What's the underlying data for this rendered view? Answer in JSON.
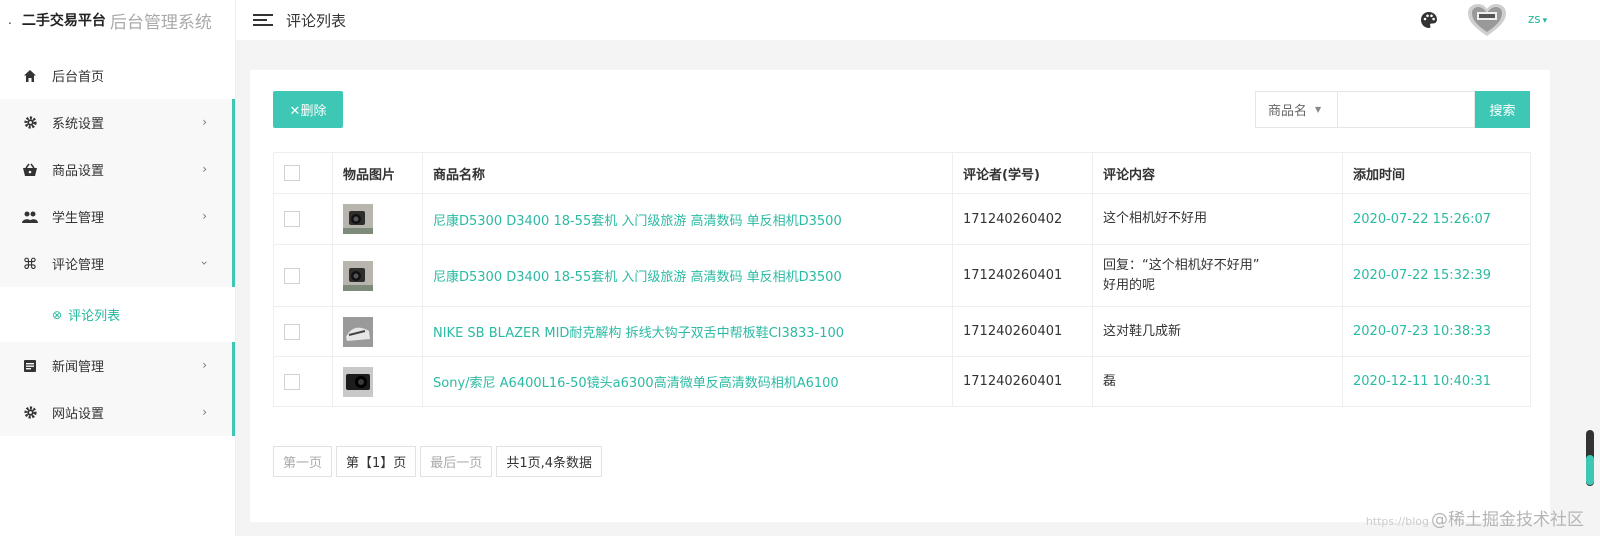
{
  "brand": {
    "prefix": ".",
    "title": "二手交易平台",
    "subtitle": "后台管理系统"
  },
  "header": {
    "page_title": "评论列表",
    "user_name": "zs"
  },
  "sidebar": {
    "items": [
      {
        "label": "后台首页",
        "icon": "home-icon"
      },
      {
        "label": "系统设置",
        "icon": "gear-icon"
      },
      {
        "label": "商品设置",
        "icon": "basket-icon"
      },
      {
        "label": "学生管理",
        "icon": "people-icon"
      },
      {
        "label": "评论管理",
        "icon": "command-icon"
      },
      {
        "label": "新闻管理",
        "icon": "news-icon"
      },
      {
        "label": "网站设置",
        "icon": "gear-icon"
      }
    ],
    "submenu": {
      "label": "评论列表"
    }
  },
  "toolbar": {
    "delete_label": "✕删除",
    "search_field_selected": "商品名",
    "search_placeholder": "",
    "search_label": "搜索"
  },
  "table": {
    "headers": [
      "物品图片",
      "商品名称",
      "评论者(学号)",
      "评论内容",
      "添加时间"
    ],
    "rows": [
      {
        "product": "尼康D5300 D3400 18-55套机 入门级旅游 高清数码 单反相机D3500",
        "reviewer": "171240260402",
        "content": "这个相机好不好用",
        "content2": "",
        "time": "2020-07-22 15:26:07"
      },
      {
        "product": "尼康D5300 D3400 18-55套机 入门级旅游 高清数码 单反相机D3500",
        "reviewer": "171240260401",
        "content": "回复：“这个相机好不好用”",
        "content2": "好用的呢",
        "time": "2020-07-22 15:32:39"
      },
      {
        "product": "NIKE SB BLAZER MID耐克解构 拆线大钩子双舌中帮板鞋CI3833-100",
        "reviewer": "171240260401",
        "content": "这对鞋几成新",
        "content2": "",
        "time": "2020-07-23 10:38:33"
      },
      {
        "product": "Sony/索尼 A6400L16-50镜头a6300高清微单反高清数码相机A6100",
        "reviewer": "171240260401",
        "content": "磊",
        "content2": "",
        "time": "2020-12-11 10:40:31"
      }
    ]
  },
  "pager": {
    "first": "第一页",
    "current": "第【1】页",
    "last": "最后一页",
    "info": "共1页,4条数据"
  },
  "watermark": {
    "prefix": "https://blog",
    "text": "@稀土掘金技术社区"
  },
  "colors": {
    "accent": "#3dc7b4",
    "link": "#2bbaa3"
  }
}
